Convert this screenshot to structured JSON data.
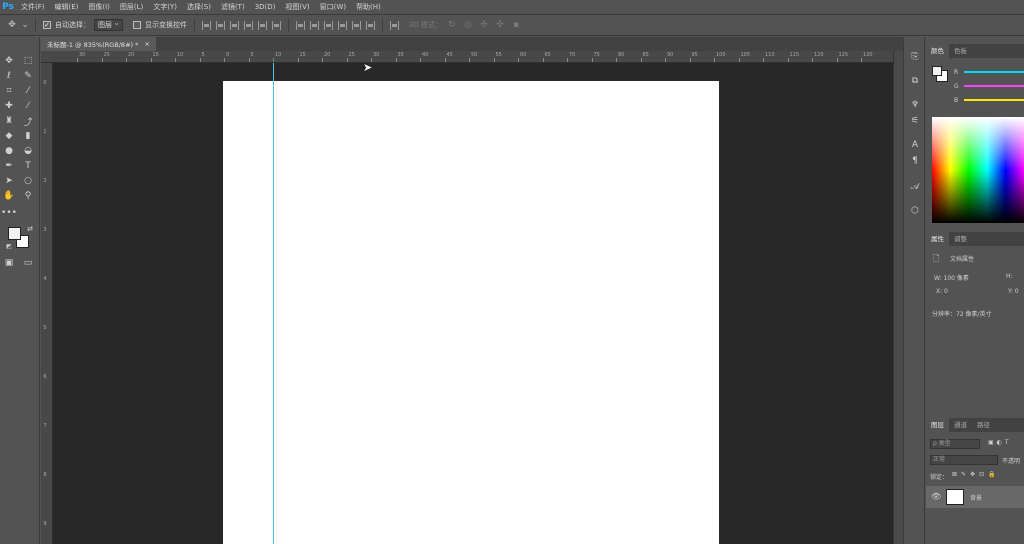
{
  "app": {
    "logo": "Ps"
  },
  "menu": [
    "文件(F)",
    "编辑(E)",
    "图像(I)",
    "图层(L)",
    "文字(Y)",
    "选择(S)",
    "滤镜(T)",
    "3D(D)",
    "视图(V)",
    "窗口(W)",
    "帮助(H)"
  ],
  "options": {
    "auto_select_label": "自动选择：",
    "auto_select_value": "图层",
    "show_transform_label": "显示变换控件",
    "mode_3d_label": "3D 模式："
  },
  "document": {
    "tab_title": "未标题-1 @ 835%(RGB/8#) *",
    "close": "×"
  },
  "ruler_top": [
    "30",
    "25",
    "20",
    "15",
    "10",
    "5",
    "0",
    "5",
    "10",
    "15",
    "20",
    "25",
    "30",
    "35",
    "40",
    "45",
    "50",
    "55",
    "60",
    "65",
    "70",
    "75",
    "80",
    "85",
    "90",
    "95",
    "100",
    "105",
    "110",
    "115",
    "120",
    "125",
    "130"
  ],
  "ruler_left": [
    "0",
    "1",
    "2",
    "3",
    "4",
    "5",
    "6",
    "7",
    "8",
    "9"
  ],
  "panels": {
    "color_tabs": [
      "颜色",
      "色板"
    ],
    "color_channels": [
      "R",
      "G",
      "B"
    ],
    "properties_tabs": [
      "属性",
      "调整"
    ],
    "properties_title": "文档属性",
    "w_label": "W:  100 像素",
    "h_label": "H:",
    "x_label": "X:  0",
    "y_label": "Y:  0",
    "resolution": "分辨率：72 像素/英寸",
    "layers_tabs": [
      "图层",
      "通道",
      "路径"
    ],
    "layers_filter": "ρ 类型",
    "blend_mode": "正常",
    "opacity_label": "不透明",
    "lock_label": "锁定：",
    "layer_name": "背景"
  },
  "colors": {
    "accent": "#31a8ff",
    "guide": "#4fc3e8",
    "canvas_bg": "#282828",
    "slider_r": "#00d8ff",
    "slider_g": "#ff40ff",
    "slider_b": "#ffe600"
  }
}
